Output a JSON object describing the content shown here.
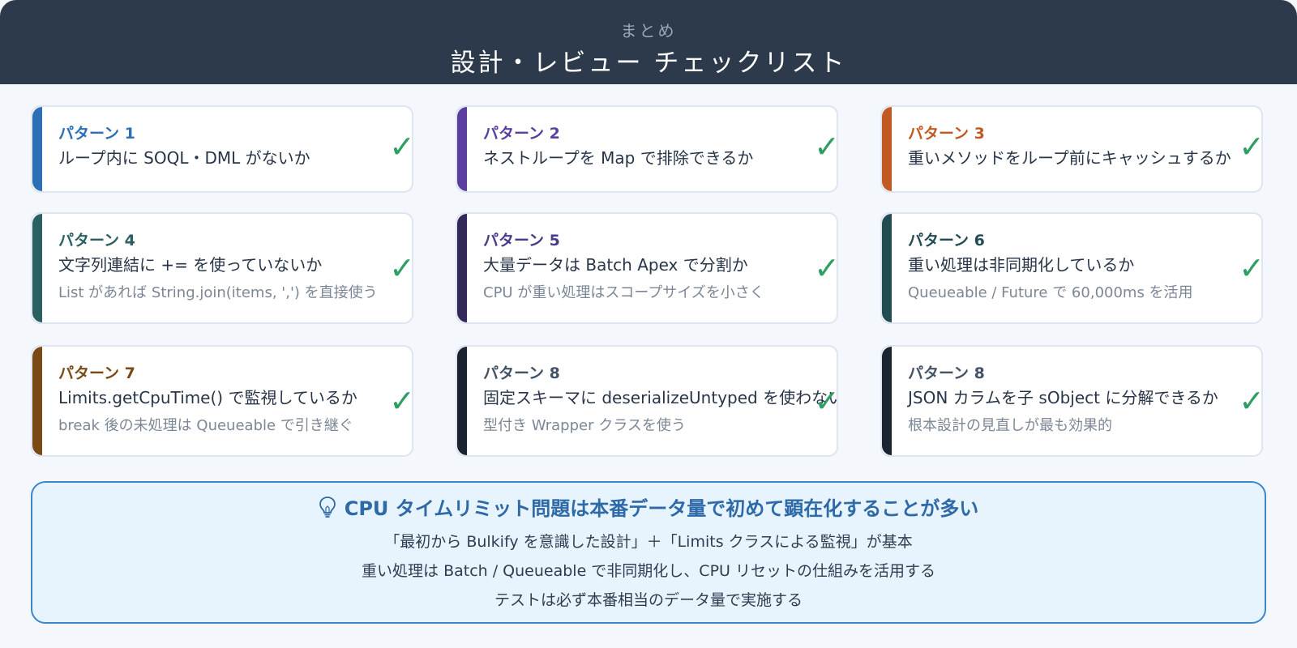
{
  "header": {
    "subtitle": "まとめ",
    "title": "設計・レビュー チェックリスト"
  },
  "cards": [
    {
      "label": "パターン 1",
      "text": "ループ内に SOQL・DML がないか",
      "sub": "",
      "accent": "#2d6fb5",
      "label_color": "#2d6fb5",
      "checked": true
    },
    {
      "label": "パターン 2",
      "text": "ネストループを Map で排除できるか",
      "sub": "",
      "accent": "#5a3fa0",
      "label_color": "#5a3fa0",
      "checked": true
    },
    {
      "label": "パターン 3",
      "text": "重いメソッドをループ前にキャッシュするか",
      "sub": "",
      "accent": "#c15a22",
      "label_color": "#c15a22",
      "checked": true
    },
    {
      "label": "パターン 4",
      "text": "文字列連結に += を使っていないか",
      "sub": "List があれば String.join(items, ',') を直接使う",
      "accent": "#2a6160",
      "label_color": "#2a6160",
      "checked": true
    },
    {
      "label": "パターン 5",
      "text": "大量データは Batch Apex で分割か",
      "sub": "CPU が重い処理はスコープサイズを小さく",
      "accent": "#33285a",
      "label_color": "#4a3a8a",
      "checked": true
    },
    {
      "label": "パターン 6",
      "text": "重い処理は非同期化しているか",
      "sub": "Queueable / Future で 60,000ms を活用",
      "accent": "#234c52",
      "label_color": "#234c52",
      "checked": true
    },
    {
      "label": "パターン 7",
      "text": "Limits.getCpuTime() で監視しているか",
      "sub": "break 後の未処理は Queueable で引き継ぐ",
      "accent": "#7a4a16",
      "label_color": "#7a4a16",
      "checked": true
    },
    {
      "label": "パターン 8",
      "text": "固定スキーマに deserializeUntyped を使わないか",
      "sub": "型付き Wrapper クラスを使う",
      "accent": "#1b2230",
      "label_color": "#445266",
      "checked": true
    },
    {
      "label": "パターン 8",
      "text": "JSON カラムを子 sObject に分解できるか",
      "sub": "根本設計の見直しが最も効果的",
      "accent": "#1b2230",
      "label_color": "#445266",
      "checked": true
    }
  ],
  "check_glyph": "✓",
  "summary": {
    "icon": "lightbulb-icon",
    "headline": "CPU タイムリミット問題は本番データ量で初めて顕在化することが多い",
    "lines": [
      "「最初から Bulkify を意識した設計」＋「Limits クラスによる監視」が基本",
      "重い処理は Batch / Queueable で非同期化し、CPU リセットの仕組みを活用する",
      "テストは必ず本番相当のデータ量で実施する"
    ],
    "accent": "#3f86c6"
  }
}
